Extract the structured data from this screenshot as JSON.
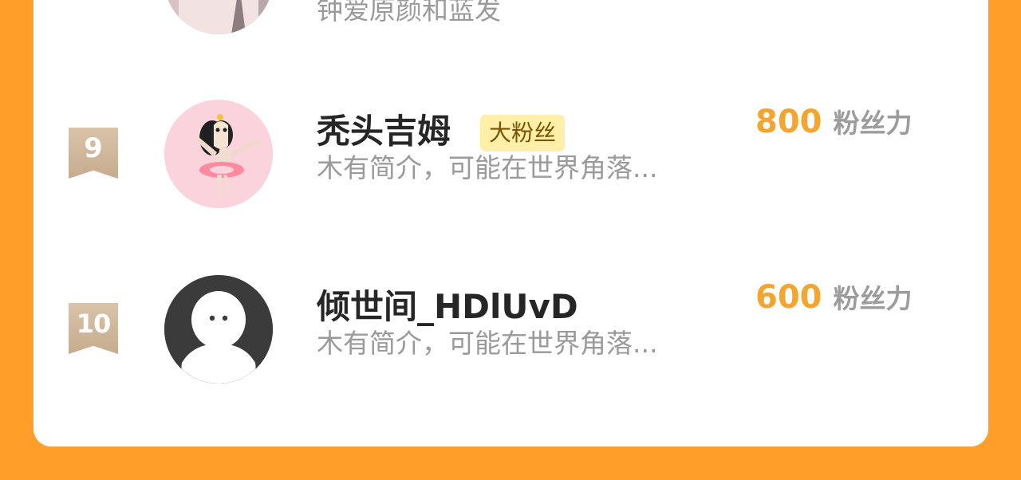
{
  "list": {
    "rows": [
      {
        "rank": "",
        "name": "",
        "bio": "钟爱原颜和蓝发",
        "tag": "",
        "score": "",
        "score_unit": ""
      },
      {
        "rank": "9",
        "name": "秃头吉姆",
        "bio": "木有简介，可能在世界角落...",
        "tag": "大粉丝",
        "score": "800",
        "score_unit": "粉丝力"
      },
      {
        "rank": "10",
        "name": "倾世间_HDlUvD",
        "bio": "木有简介，可能在世界角落...",
        "tag": "",
        "score": "600",
        "score_unit": "粉丝力"
      }
    ]
  },
  "colors": {
    "page_background": "#FF9F2A",
    "card_background": "#FFFFFF",
    "score_accent": "#F4A530",
    "tag_background": "#FFEFA8",
    "rank_badge": "#CFB598"
  },
  "icons": {
    "rank_badge": "ribbon-bookmark-icon",
    "default_avatar": "default-user-silhouette-icon",
    "ballerina_avatar": "ballerina-avatar-image"
  }
}
